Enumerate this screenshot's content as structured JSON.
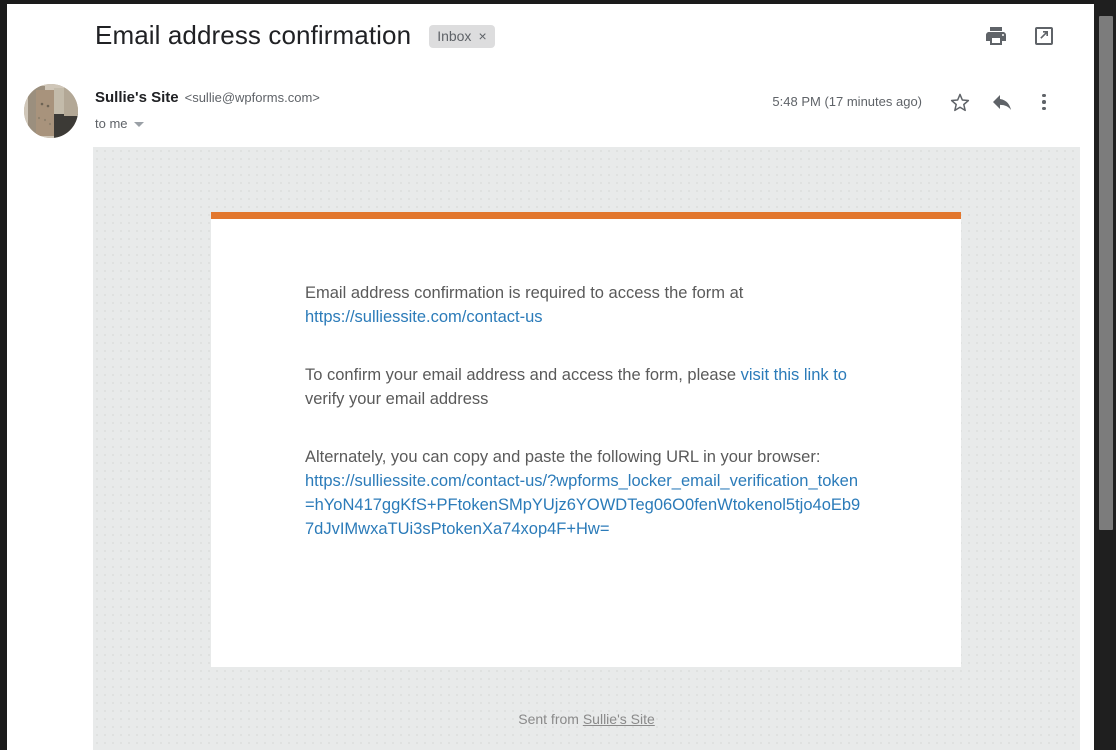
{
  "header": {
    "subject": "Email address confirmation",
    "label_chip": "Inbox",
    "chip_close": "×",
    "print_icon": "print-icon",
    "open_in_new_icon": "open-in-new-window-icon"
  },
  "message": {
    "sender_name": "Sullie's Site",
    "sender_email": "<sullie@wpforms.com>",
    "recipient": "to me",
    "recipient_caret": "details-caret-icon",
    "timestamp": "5:48 PM (17 minutes ago)",
    "star_icon": "star-icon",
    "reply_icon": "reply-icon",
    "more_icon": "more-options-icon",
    "avatar": "sender-avatar"
  },
  "body": {
    "accent_color": "#e2772e",
    "background_color": "#e8eaea",
    "link_color": "#2b7bb9",
    "paragraph_1_text": "Email address confirmation is required to access the form at ",
    "paragraph_1_link": "https://sulliessite.com/contact-us",
    "paragraph_2_prefix": "To confirm your email address and access the form, please ",
    "paragraph_2_link": "visit this link to",
    "paragraph_2_suffix": " verify your email address",
    "paragraph_3_text": "Alternately, you can copy and paste the following URL in your browser:",
    "paragraph_3_link": "https://sulliessite.com/contact-us/?wpforms_locker_email_verification_token=hYoN417ggKfS+PFtokenSMpYUjz6YOWDTeg06O0fenWtokenol5tjo4oEb97dJvIMwxaTUi3sPtokenXa74xop4F+Hw="
  },
  "footer": {
    "sent_from_prefix": "Sent from ",
    "sent_from_site": "Sullie's Site"
  }
}
